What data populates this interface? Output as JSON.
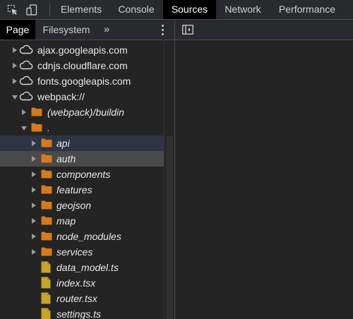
{
  "toolbar": {
    "icons": [
      "select-element-icon",
      "device-toolbar-icon"
    ],
    "tabs": [
      {
        "label": "Elements",
        "active": false
      },
      {
        "label": "Console",
        "active": false
      },
      {
        "label": "Sources",
        "active": true
      },
      {
        "label": "Network",
        "active": false
      },
      {
        "label": "Performance",
        "active": false
      }
    ]
  },
  "navigator": {
    "tabs": [
      {
        "label": "Page",
        "active": true
      },
      {
        "label": "Filesystem",
        "active": false
      }
    ],
    "more_tabs_glyph": "»",
    "tree": [
      {
        "label": "ajax.googleapis.com",
        "icon": "cloud-icon",
        "expanded": false,
        "italic": false
      },
      {
        "label": "cdnjs.cloudflare.com",
        "icon": "cloud-icon",
        "expanded": false,
        "italic": false
      },
      {
        "label": "fonts.googleapis.com",
        "icon": "cloud-icon",
        "expanded": false,
        "italic": false
      },
      {
        "label": "webpack://",
        "icon": "cloud-icon",
        "expanded": true,
        "italic": false
      },
      {
        "label": "(webpack)/buildin",
        "icon": "folder-icon",
        "expanded": false,
        "italic": true
      },
      {
        "label": ".",
        "icon": "folder-icon",
        "expanded": true,
        "italic": true
      },
      {
        "label": "api",
        "icon": "folder-icon",
        "expanded": false,
        "italic": true,
        "selected": "dim"
      },
      {
        "label": "auth",
        "icon": "folder-icon",
        "expanded": false,
        "italic": true,
        "selected": "focus"
      },
      {
        "label": "components",
        "icon": "folder-icon",
        "expanded": false,
        "italic": true
      },
      {
        "label": "features",
        "icon": "folder-icon",
        "expanded": false,
        "italic": true
      },
      {
        "label": "geojson",
        "icon": "folder-icon",
        "expanded": false,
        "italic": true
      },
      {
        "label": "map",
        "icon": "folder-icon",
        "expanded": false,
        "italic": true
      },
      {
        "label": "node_modules",
        "icon": "folder-icon",
        "expanded": false,
        "italic": true
      },
      {
        "label": "services",
        "icon": "folder-icon",
        "expanded": false,
        "italic": true
      },
      {
        "label": "data_model.ts",
        "icon": "file-icon",
        "expanded": null,
        "italic": true
      },
      {
        "label": "index.tsx",
        "icon": "file-icon",
        "expanded": null,
        "italic": true
      },
      {
        "label": "router.tsx",
        "icon": "file-icon",
        "expanded": null,
        "italic": true
      },
      {
        "label": "settings.ts",
        "icon": "file-icon",
        "expanded": null,
        "italic": true
      }
    ]
  },
  "colors": {
    "background": "#242424",
    "active_tab": "#000000",
    "folder": "#d47a1f",
    "file": "#c8a32a",
    "selection": "#4a4a4a",
    "selection_dim": "#2d3444"
  }
}
